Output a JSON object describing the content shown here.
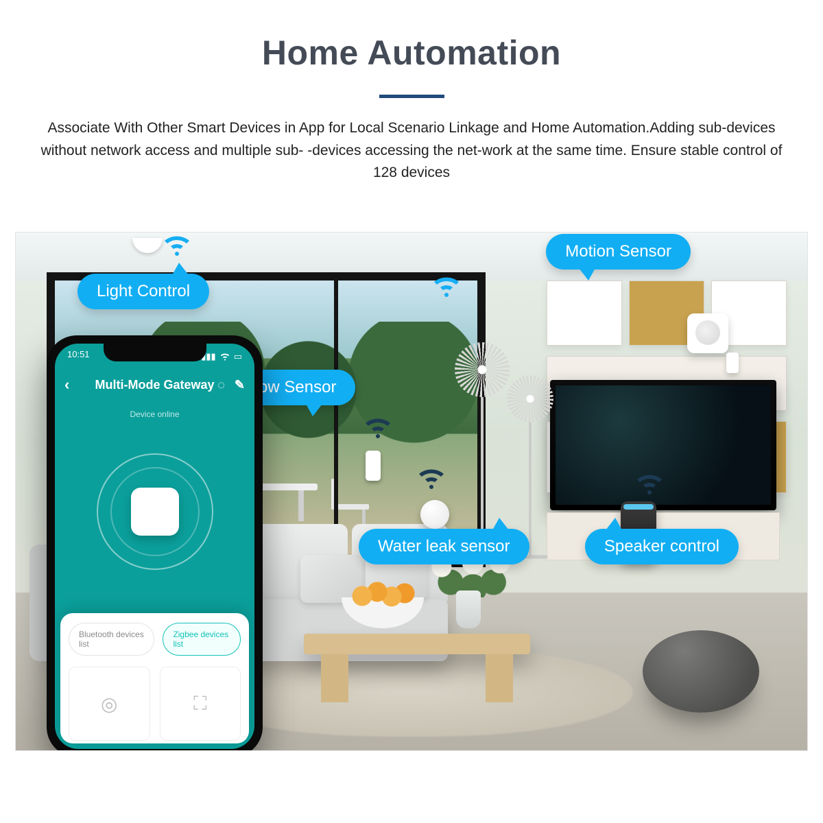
{
  "header": {
    "title": "Home Automation",
    "subtitle": "Associate With Other Smart Devices in App for Local Scenario Linkage and  Home Automation.Adding sub-devices without network access and multiple sub- -devices accessing the net-work at the same time. Ensure stable control of 128 devices"
  },
  "callouts": {
    "light": "Light Control",
    "motion": "Motion Sensor",
    "door": "Door & Window Sensor",
    "leak": "Water leak sensor",
    "speaker": "Speaker control"
  },
  "phone": {
    "status_time": "10:51",
    "app_title": "Multi-Mode Gateway",
    "device_subtext": "Device online",
    "tabs": {
      "bluetooth": "Bluetooth devices list",
      "zigbee": "Zigbee devices list"
    }
  }
}
